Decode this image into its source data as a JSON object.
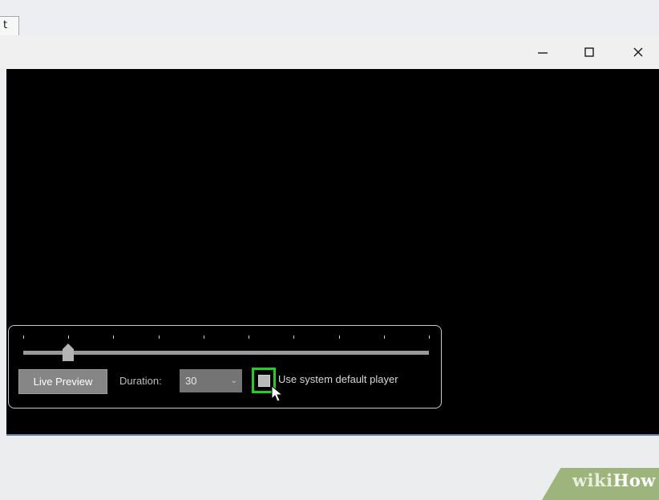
{
  "tab": {
    "label_fragment": "t"
  },
  "window": {
    "controls": {
      "minimize": "minimize-icon",
      "maximize": "maximize-icon",
      "close": "close-icon"
    }
  },
  "player": {
    "slider": {
      "tick_count": 10,
      "value_fraction": 0.11
    },
    "live_preview_label": "Live Preview",
    "duration_label": "Duration:",
    "duration_value": "30",
    "use_default_player_label": "Use system default player",
    "use_default_player_checked": false
  },
  "watermark": {
    "part1": "wiki",
    "part2": "How"
  },
  "colors": {
    "highlight": "#22ce22",
    "video_background": "#000000",
    "watermark_bg": "#9db57c"
  }
}
